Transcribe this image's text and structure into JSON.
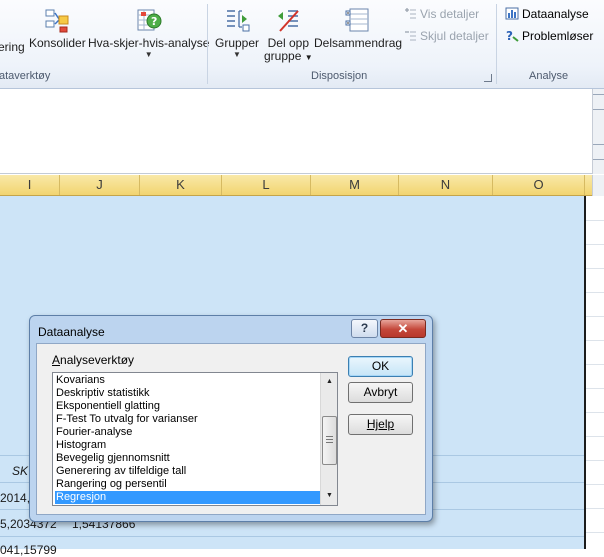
{
  "ribbon": {
    "buttons": {
      "rangering": "ering",
      "konsolider": "Konsolider",
      "hva_skjer": "Hva-skjer-hvis-analyse",
      "grupper": "Grupper",
      "del_opp_line1": "Del opp",
      "del_opp_line2": "gruppe",
      "delsammendrag": "Delsammendrag",
      "vis_detaljer": "Vis detaljer",
      "skjul_detaljer": "Skjul detaljer",
      "dataanalyse": "Dataanalyse",
      "problemloser": "Problemløser"
    },
    "group_labels": {
      "dataverktoy": "ataverktøy",
      "disposisjon": "Disposisjon",
      "analyse": "Analyse"
    }
  },
  "columns": [
    "I",
    "J",
    "K",
    "L",
    "M",
    "N",
    "O"
  ],
  "cells": {
    "sk_header": "SK",
    "row1_a": "2014,9",
    "row2_a": "5,2034372",
    "row2_b": "1,54137866",
    "row3_a": "041,15799"
  },
  "dialog": {
    "title": "Dataanalyse",
    "help_glyph": "?",
    "close_glyph": "✕",
    "tools_label_underlined": "A",
    "tools_label_rest": "nalyseverktøy",
    "items": [
      "Kovarians",
      "Deskriptiv statistikk",
      "Eksponentiell glatting",
      "F-Test To utvalg for varianser",
      "Fourier-analyse",
      "Histogram",
      "Bevegelig gjennomsnitt",
      "Generering av tilfeldige tall",
      "Rangering og persentil",
      "Regresjon"
    ],
    "selected_item": "Regresjon",
    "ok_label": "OK",
    "cancel_label": "Avbryt",
    "help_label": "Hjelp"
  },
  "colors": {
    "sheet_selection": "#cde4f7",
    "column_header": "#f2d470",
    "dialog_frame": "#bcd4ef",
    "list_selection": "#3399ff",
    "close_button": "#c4473a"
  }
}
